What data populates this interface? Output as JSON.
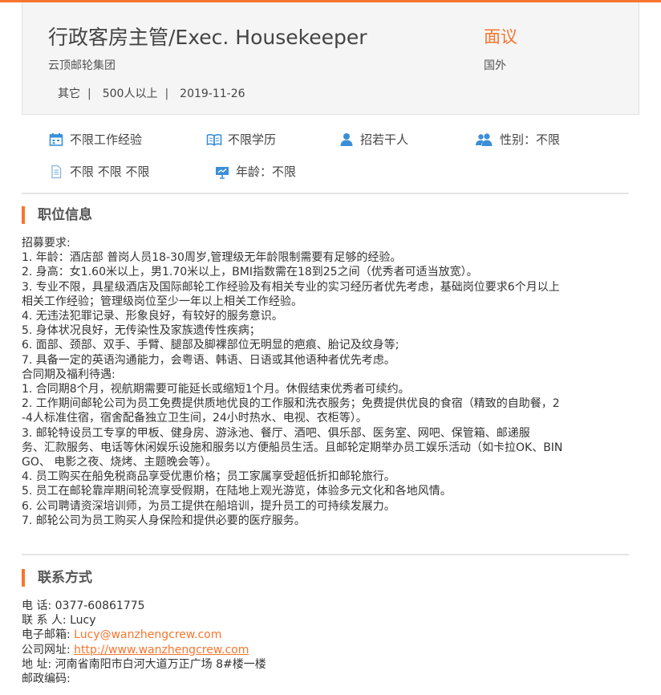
{
  "header": {
    "title": "行政客房主管/Exec. Housekeeper",
    "company": "云顶邮轮集团",
    "industry": "其它",
    "size": "500人以上",
    "date": "2019-11-26",
    "separator": "|",
    "salary": "面议",
    "location": "国外"
  },
  "requirements": {
    "experience": "不限工作经验",
    "education": "不限学历",
    "headcount": "招若干人",
    "gender": "性别：不限",
    "languages": "不限 不限 不限",
    "age": "年龄：不限"
  },
  "sections": {
    "job_info": "职位信息",
    "contact": "联系方式"
  },
  "description": [
    "招募要求:",
    "1. 年龄：酒店部 普岗人员18-30周岁,管理级无年龄限制需要有足够的经验。",
    "2. 身高：女1.60米以上，男1.70米以上，BMI指数需在18到25之间（优秀者可适当放宽）。",
    "3. 专业不限，具星级酒店及国际邮轮工作经验及有相关专业的实习经历者优先考虑，基础岗位要求6个月以上",
    "相关工作经验；管理级岗位至少一年以上相关工作经验。",
    "4. 无违法犯罪记录、形象良好，有较好的服务意识。",
    "5. 身体状况良好，无传染性及家族遗传性疾病；",
    "6. 面部、颈部、双手、手臂、腿部及脚裸部位无明显的疤痕、胎记及纹身等;",
    "7. 具备一定的英语沟通能力，会粤语、韩语、日语或其他语种者优先考虑。",
    "合同期及福利待遇:",
    "1. 合同期8个月，视航期需要可能延长或缩短1个月。休假结束优秀者可续约。",
    "2. 工作期间邮轮公司为员工免费提供质地优良的工作服和洗衣服务；免费提供优良的食宿（精致的自助餐，2",
    "-4人标准住宿，宿舍配备独立卫生间，24小时热水、电视、衣柜等）。",
    "3. 邮轮特设员工专享的甲板、健身房、游泳池、餐厅、酒吧、俱乐部、医务室、网吧、保管箱、邮递服",
    "务、汇款服务、电话等休闲娱乐设施和服务以方便船员生活。且邮轮定期举办员工娱乐活动（如卡拉OK、BIN",
    "GO、 电影之夜、烧烤、主题晚会等）。",
    "4. 员工购买在船免税商品享受优惠价格；员工家属享受超低折扣邮轮旅行。",
    "5. 员工在邮轮靠岸期间轮流享受假期，在陆地上观光游览，体验多元文化和各地风情。",
    "6. 公司聘请资深培训师，为员工提供在船培训，提升员工的可持续发展力。",
    "7. 邮轮公司为员工购买人身保险和提供必要的医疗服务。"
  ],
  "contact": {
    "phone_label": "电 话: ",
    "phone": "0377-60861775",
    "person_label": "联 系 人: ",
    "person": "Lucy",
    "email_label": "电子邮箱: ",
    "email": "Lucy@wanzhengcrew.com",
    "website_label": "公司网址: ",
    "website": "http://www.wanzhengcrew.com",
    "address_label": "地 址: ",
    "address": "河南省南阳市白河大道万正广场 8#楼一楼",
    "postcode_label": "邮政编码: ",
    "postcode": ""
  },
  "colors": {
    "accent": "#f7752d",
    "icon_blue": "#3b8fd9"
  },
  "icons": {
    "experience": "calendar-icon",
    "education": "book-icon",
    "headcount": "person-icon",
    "gender": "people-icon",
    "languages": "document-icon",
    "age": "chart-board-icon"
  }
}
